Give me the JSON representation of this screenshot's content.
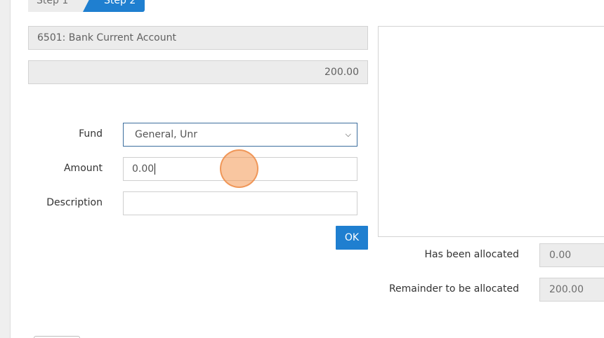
{
  "steps": [
    {
      "label": "Step 1"
    },
    {
      "label": "Step 2"
    }
  ],
  "account": {
    "value": "6501: Bank Current Account"
  },
  "total": {
    "value": "200.00"
  },
  "form": {
    "fund_label": "Fund",
    "fund_selected": "General, Unr",
    "amount_label": "Amount",
    "amount_value": "0.00",
    "description_label": "Description",
    "description_value": "",
    "ok_label": "OK"
  },
  "summary": {
    "allocated_label": "Has been allocated",
    "allocated_value": "0.00",
    "remainder_label": "Remainder to be allocated",
    "remainder_value": "200.00"
  },
  "icons": {
    "select_chevron": "chevron-down-icon"
  },
  "colors": {
    "accent": "#1f7fd0",
    "readonly_bg": "#ececec",
    "click_indicator": "#f49852"
  }
}
